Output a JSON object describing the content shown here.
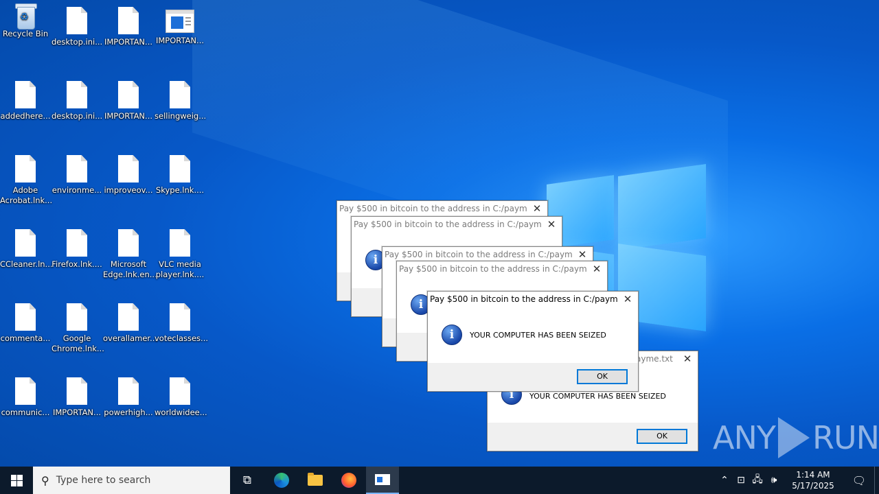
{
  "desktop": {
    "icons": [
      {
        "label": "Recycle Bin",
        "icon": "recycle-bin-icon"
      },
      {
        "label": "desktop.ini...",
        "icon": "file-icon"
      },
      {
        "label": "IMPORTAN...",
        "icon": "file-icon"
      },
      {
        "label": "IMPORTAN...",
        "icon": "application-icon"
      },
      {
        "label": "addedhere...",
        "icon": "file-icon"
      },
      {
        "label": "desktop.ini...",
        "icon": "file-icon"
      },
      {
        "label": "IMPORTAN...",
        "icon": "file-icon"
      },
      {
        "label": "sellingweig...",
        "icon": "file-icon"
      },
      {
        "label": "Adobe Acrobat.lnk...",
        "icon": "file-icon"
      },
      {
        "label": "environme...",
        "icon": "file-icon"
      },
      {
        "label": "improveov...",
        "icon": "file-icon"
      },
      {
        "label": "Skype.lnk....",
        "icon": "file-icon"
      },
      {
        "label": "CCleaner.ln...",
        "icon": "file-icon"
      },
      {
        "label": "Firefox.lnk....",
        "icon": "file-icon"
      },
      {
        "label": "Microsoft Edge.lnk.en...",
        "icon": "file-icon"
      },
      {
        "label": "VLC media player.lnk....",
        "icon": "file-icon"
      },
      {
        "label": "commenta...",
        "icon": "file-icon"
      },
      {
        "label": "Google Chrome.lnk...",
        "icon": "file-icon"
      },
      {
        "label": "overallamer...",
        "icon": "file-icon"
      },
      {
        "label": "voteclasses...",
        "icon": "file-icon"
      },
      {
        "label": "communic...",
        "icon": "file-icon"
      },
      {
        "label": "IMPORTAN...",
        "icon": "file-icon"
      },
      {
        "label": "powerhigh...",
        "icon": "file-icon"
      },
      {
        "label": "worldwidee...",
        "icon": "file-icon"
      }
    ]
  },
  "dialogs": {
    "title": "Pay $500 in bitcoin to the address in C:/payme.txt",
    "title_partial": "ayme.txt",
    "message": "YOUR COMPUTER HAS BEEN SEIZED",
    "ok_label": "OK",
    "close_glyph": "✕",
    "info_glyph": "i"
  },
  "watermark": {
    "left": "ANY",
    "right": "RUN"
  },
  "taskbar": {
    "search_placeholder": "Type here to search",
    "time": "1:14 AM",
    "date": "5/17/2025",
    "pinned": [
      "task-view-icon",
      "edge-icon",
      "file-explorer-icon",
      "firefox-icon",
      "application-icon"
    ]
  }
}
